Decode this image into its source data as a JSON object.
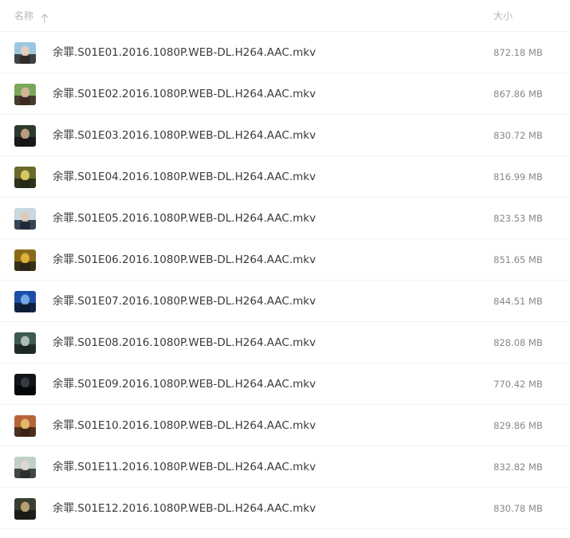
{
  "header": {
    "name_label": "名称",
    "size_label": "大小",
    "sort_icon": "arrow-up-icon"
  },
  "files": [
    {
      "name": "余罪.S01E01.2016.1080P.WEB-DL.H264.AAC.mkv",
      "size": "872.18 MB",
      "thumb_colors": [
        "#9cc6e0",
        "#2e2a28",
        "#e7d2bd"
      ]
    },
    {
      "name": "余罪.S01E02.2016.1080P.WEB-DL.H264.AAC.mkv",
      "size": "867.86 MB",
      "thumb_colors": [
        "#7aa85a",
        "#3a2a22",
        "#d8b89a"
      ]
    },
    {
      "name": "余罪.S01E03.2016.1080P.WEB-DL.H264.AAC.mkv",
      "size": "830.72 MB",
      "thumb_colors": [
        "#2c3a2e",
        "#151515",
        "#caa58a"
      ]
    },
    {
      "name": "余罪.S01E04.2016.1080P.WEB-DL.H264.AAC.mkv",
      "size": "816.99 MB",
      "thumb_colors": [
        "#6b6a2a",
        "#222a18",
        "#e4d36a"
      ]
    },
    {
      "name": "余罪.S01E05.2016.1080P.WEB-DL.H264.AAC.mkv",
      "size": "823.53 MB",
      "thumb_colors": [
        "#c8d8e0",
        "#1f2a3a",
        "#e0c8b8"
      ]
    },
    {
      "name": "余罪.S01E06.2016.1080P.WEB-DL.H264.AAC.mkv",
      "size": "851.65 MB",
      "thumb_colors": [
        "#8a6a1a",
        "#2a2416",
        "#e8b83a"
      ]
    },
    {
      "name": "余罪.S01E07.2016.1080P.WEB-DL.H264.AAC.mkv",
      "size": "844.51 MB",
      "thumb_colors": [
        "#1e4fa8",
        "#0d1a30",
        "#7fb0e8"
      ]
    },
    {
      "name": "余罪.S01E08.2016.1080P.WEB-DL.H264.AAC.mkv",
      "size": "828.08 MB",
      "thumb_colors": [
        "#3e5a52",
        "#1a2420",
        "#b9c8c0"
      ]
    },
    {
      "name": "余罪.S01E09.2016.1080P.WEB-DL.H264.AAC.mkv",
      "size": "770.42 MB",
      "thumb_colors": [
        "#121418",
        "#050608",
        "#3a3e48"
      ]
    },
    {
      "name": "余罪.S01E10.2016.1080P.WEB-DL.H264.AAC.mkv",
      "size": "829.86 MB",
      "thumb_colors": [
        "#b8643a",
        "#3a2418",
        "#e8c26a"
      ]
    },
    {
      "name": "余罪.S01E11.2016.1080P.WEB-DL.H264.AAC.mkv",
      "size": "832.82 MB",
      "thumb_colors": [
        "#c0d0c8",
        "#2a302c",
        "#e0d8d0"
      ]
    },
    {
      "name": "余罪.S01E12.2016.1080P.WEB-DL.H264.AAC.mkv",
      "size": "830.78 MB",
      "thumb_colors": [
        "#3a4030",
        "#181a14",
        "#c8a878"
      ]
    }
  ]
}
